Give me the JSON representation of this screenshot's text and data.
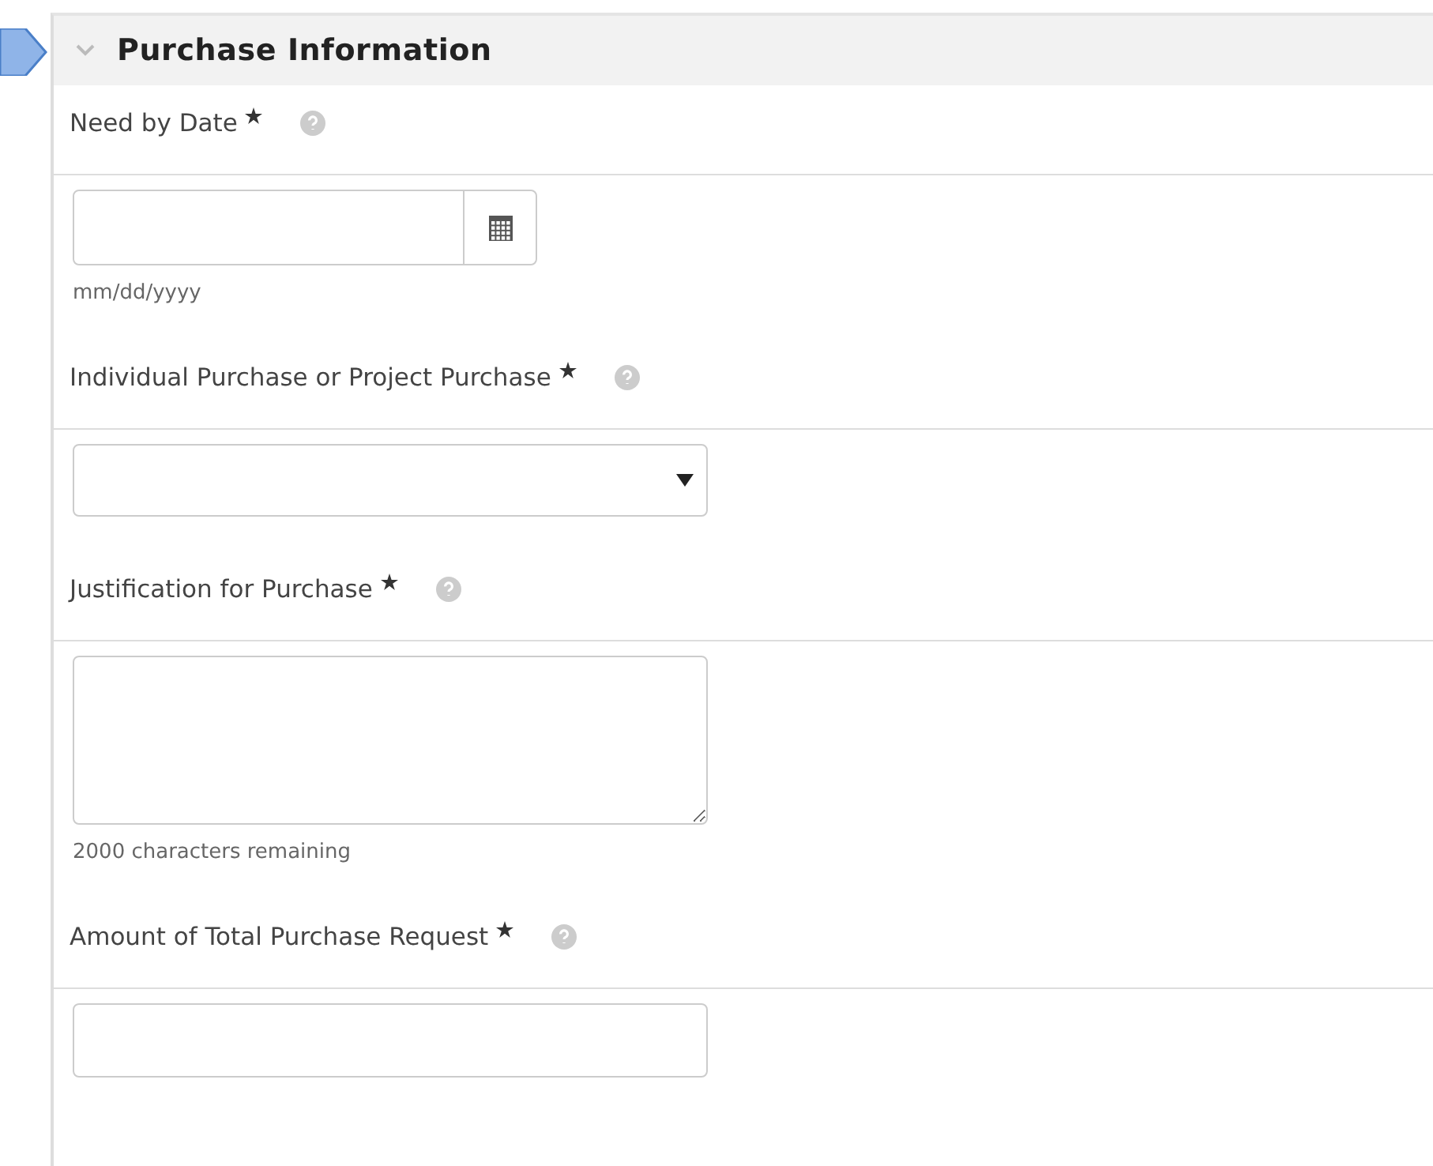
{
  "section": {
    "title": "Purchase Information",
    "expanded": true
  },
  "fields": [
    {
      "kind": "date",
      "label": "Need by Date",
      "required": true,
      "hint": "mm/dd/yyyy"
    },
    {
      "kind": "select",
      "label": "Individual Purchase or Project Purchase",
      "required": true
    },
    {
      "kind": "textarea",
      "label": "Justification for Purchase",
      "required": true,
      "hint": "2000 characters remaining"
    },
    {
      "kind": "text",
      "label": "Amount of Total Purchase Request",
      "required": true
    }
  ]
}
